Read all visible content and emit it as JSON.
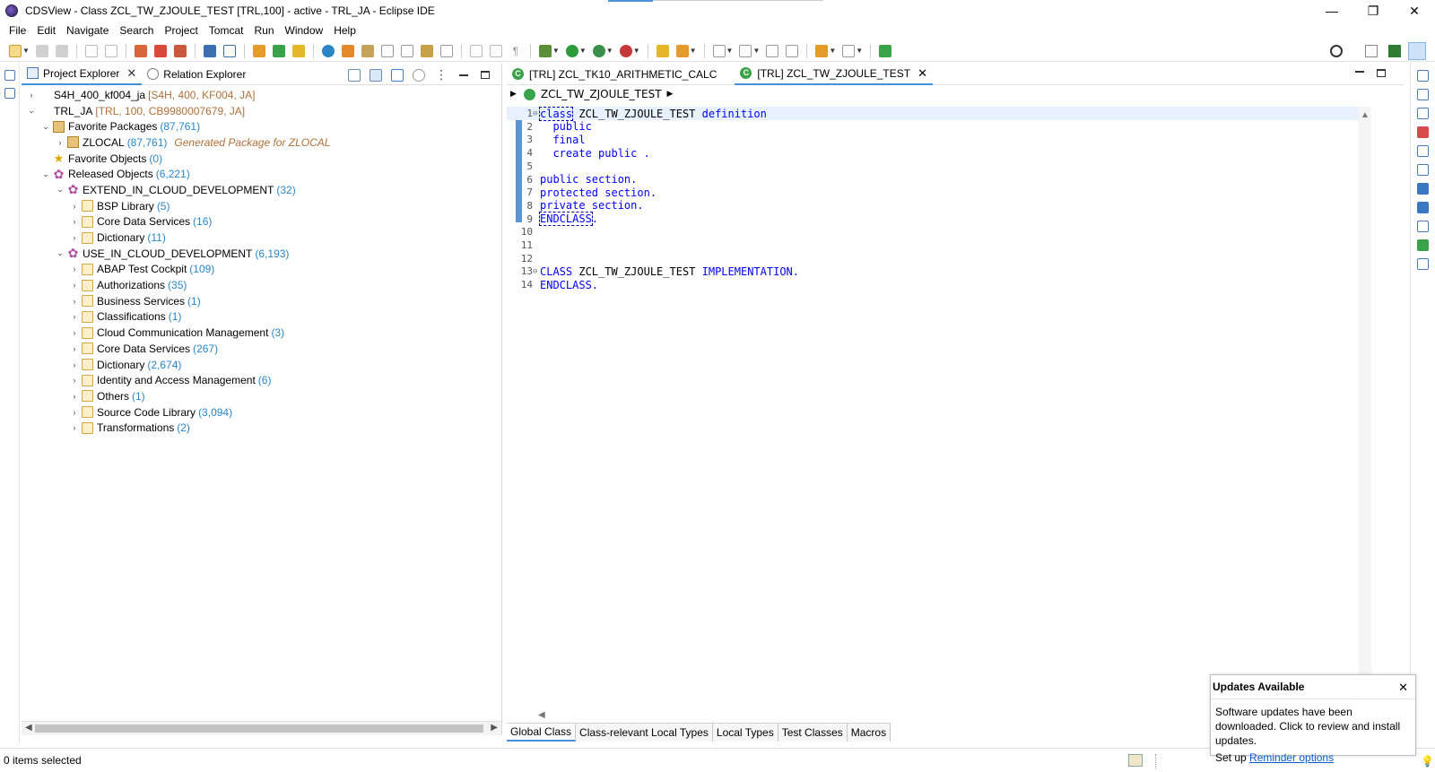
{
  "window": {
    "title": "CDSView - Class ZCL_TW_ZJOULE_TEST [TRL,100] - active - TRL_JA - Eclipse IDE",
    "minimize": "—",
    "restore": "❐",
    "close": "✕"
  },
  "menu": [
    "File",
    "Edit",
    "Navigate",
    "Search",
    "Project",
    "Tomcat",
    "Run",
    "Window",
    "Help"
  ],
  "explorer": {
    "tabs": [
      {
        "label": "Project Explorer",
        "icon": "project-explorer-icon"
      },
      {
        "label": "Relation Explorer",
        "icon": "relation-explorer-icon"
      }
    ],
    "tree": [
      {
        "indent": 0,
        "twisty": "›",
        "icon": "project",
        "label": "S4H_400_kf004_ja",
        "sys": "[S4H, 400, KF004, JA]"
      },
      {
        "indent": 0,
        "twisty": "⌄",
        "icon": "project",
        "label": "TRL_JA",
        "sys": "[TRL, 100, CB9980007679, JA]"
      },
      {
        "indent": 1,
        "twisty": "⌄",
        "icon": "pkg",
        "label": "Favorite Packages",
        "count": "(87,761)"
      },
      {
        "indent": 2,
        "twisty": "›",
        "icon": "pkg",
        "label": "ZLOCAL",
        "count": "(87,761)",
        "desc": "Generated Package for ZLOCAL"
      },
      {
        "indent": 1,
        "twisty": "",
        "icon": "star",
        "label": "Favorite Objects",
        "count": "(0)"
      },
      {
        "indent": 1,
        "twisty": "⌄",
        "icon": "gear",
        "label": "Released Objects",
        "count": "(6,221)"
      },
      {
        "indent": 2,
        "twisty": "⌄",
        "icon": "gear",
        "label": "EXTEND_IN_CLOUD_DEVELOPMENT",
        "count": "(32)"
      },
      {
        "indent": 3,
        "twisty": "›",
        "icon": "folder",
        "label": "BSP Library",
        "count": "(5)"
      },
      {
        "indent": 3,
        "twisty": "›",
        "icon": "folder",
        "label": "Core Data Services",
        "count": "(16)"
      },
      {
        "indent": 3,
        "twisty": "›",
        "icon": "folder",
        "label": "Dictionary",
        "count": "(11)"
      },
      {
        "indent": 2,
        "twisty": "⌄",
        "icon": "gear",
        "label": "USE_IN_CLOUD_DEVELOPMENT",
        "count": "(6,193)"
      },
      {
        "indent": 3,
        "twisty": "›",
        "icon": "folder",
        "label": "ABAP Test Cockpit",
        "count": "(109)"
      },
      {
        "indent": 3,
        "twisty": "›",
        "icon": "folder",
        "label": "Authorizations",
        "count": "(35)"
      },
      {
        "indent": 3,
        "twisty": "›",
        "icon": "folder",
        "label": "Business Services",
        "count": "(1)"
      },
      {
        "indent": 3,
        "twisty": "›",
        "icon": "folder",
        "label": "Classifications",
        "count": "(1)"
      },
      {
        "indent": 3,
        "twisty": "›",
        "icon": "folder",
        "label": "Cloud Communication Management",
        "count": "(3)"
      },
      {
        "indent": 3,
        "twisty": "›",
        "icon": "folder",
        "label": "Core Data Services",
        "count": "(267)"
      },
      {
        "indent": 3,
        "twisty": "›",
        "icon": "folder",
        "label": "Dictionary",
        "count": "(2,674)"
      },
      {
        "indent": 3,
        "twisty": "›",
        "icon": "folder",
        "label": "Identity and Access Management",
        "count": "(6)"
      },
      {
        "indent": 3,
        "twisty": "›",
        "icon": "folder",
        "label": "Others",
        "count": "(1)"
      },
      {
        "indent": 3,
        "twisty": "›",
        "icon": "folder",
        "label": "Source Code Library",
        "count": "(3,094)"
      },
      {
        "indent": 3,
        "twisty": "›",
        "icon": "folder",
        "label": "Transformations",
        "count": "(2)"
      }
    ]
  },
  "editor": {
    "tabs": [
      {
        "label": "[TRL] ZCL_TK10_ARITHMETIC_CALC",
        "active": false
      },
      {
        "label": "[TRL] ZCL_TW_ZJOULE_TEST",
        "active": true
      }
    ],
    "breadcrumb": "ZCL_TW_ZJOULE_TEST",
    "code": [
      {
        "n": "1",
        "fold": "⊖",
        "parts": [
          {
            "t": "class",
            "c": "kw boxed"
          },
          {
            "t": " ZCL_TW_ZJOULE_TEST "
          },
          {
            "t": "definition",
            "c": "kw"
          }
        ]
      },
      {
        "n": "2",
        "parts": [
          {
            "t": "  "
          },
          {
            "t": "public",
            "c": "kw"
          }
        ]
      },
      {
        "n": "3",
        "parts": [
          {
            "t": "  "
          },
          {
            "t": "final",
            "c": "kw"
          }
        ]
      },
      {
        "n": "4",
        "parts": [
          {
            "t": "  "
          },
          {
            "t": "create public .",
            "c": "kw"
          }
        ]
      },
      {
        "n": "5",
        "parts": []
      },
      {
        "n": "6",
        "parts": [
          {
            "t": "public section.",
            "c": "kw"
          }
        ]
      },
      {
        "n": "7",
        "parts": [
          {
            "t": "protected section.",
            "c": "kw"
          }
        ]
      },
      {
        "n": "8",
        "parts": [
          {
            "t": "private section.",
            "c": "kw"
          }
        ]
      },
      {
        "n": "9",
        "parts": [
          {
            "t": "ENDCLASS",
            "c": "kw boxed"
          },
          {
            "t": ".",
            "c": "kw"
          }
        ]
      },
      {
        "n": "10",
        "parts": []
      },
      {
        "n": "11",
        "parts": []
      },
      {
        "n": "12",
        "parts": []
      },
      {
        "n": "13",
        "fold": "⊖",
        "parts": [
          {
            "t": "CLASS",
            "c": "kw"
          },
          {
            "t": " ZCL_TW_ZJOULE_TEST "
          },
          {
            "t": "IMPLEMENTATION.",
            "c": "kw"
          }
        ]
      },
      {
        "n": "14",
        "parts": [
          {
            "t": "ENDCLASS.",
            "c": "kw"
          }
        ]
      }
    ],
    "bottom_tabs": [
      "Global Class",
      "Class-relevant Local Types",
      "Local Types",
      "Test Classes",
      "Macros"
    ]
  },
  "status": {
    "text": "0 items selected"
  },
  "notification": {
    "title": "Updates Available",
    "body": "Software updates have been downloaded. Click to review and install updates.",
    "footer_prefix": "Set up ",
    "link": "Reminder options"
  }
}
